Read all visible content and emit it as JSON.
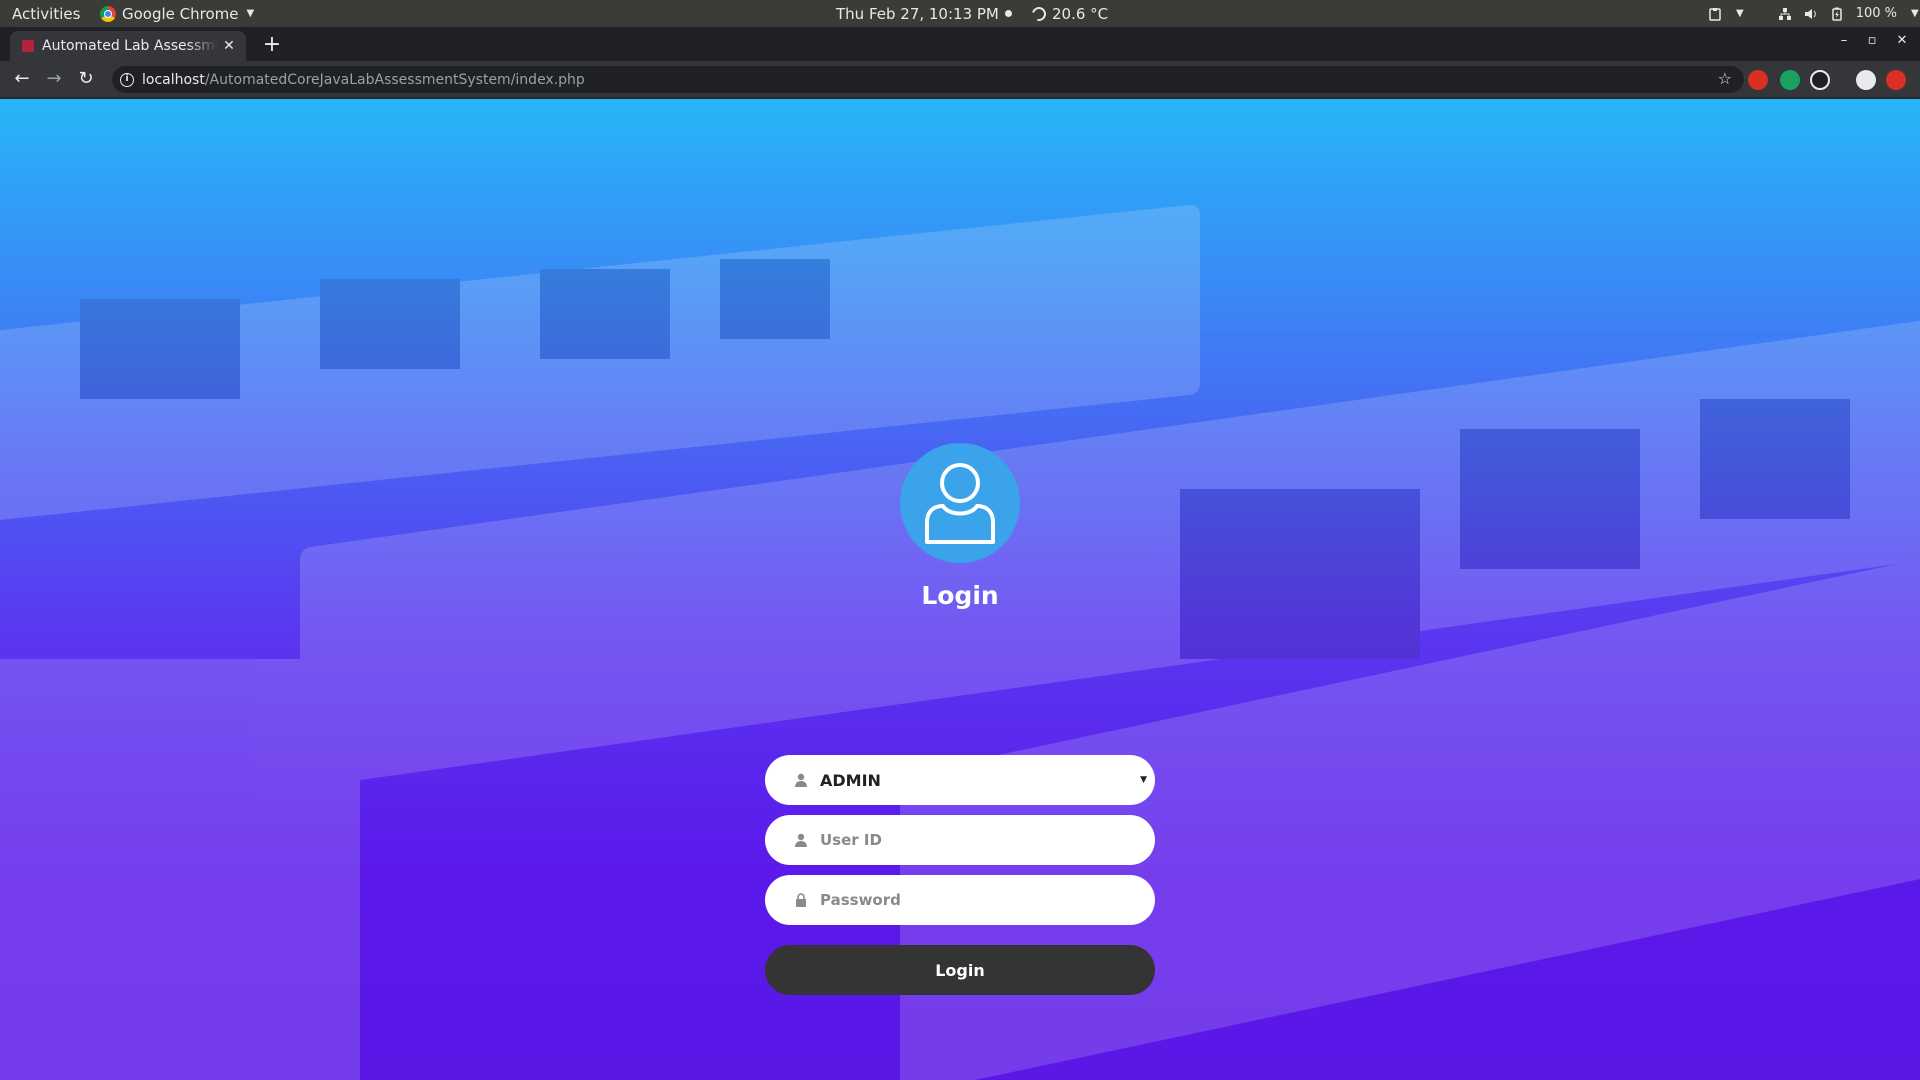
{
  "topbar": {
    "activities": "Activities",
    "app_name": "Google Chrome",
    "datetime": "Thu Feb 27, 10:13 PM",
    "weather": "20.6 °C",
    "battery": "100 %"
  },
  "browser": {
    "tab_title": "Automated Lab Assessment System",
    "url_host": "localhost",
    "url_path": "/AutomatedCoreJavaLabAssessmentSystem/index.php"
  },
  "login": {
    "title": "Login",
    "role_selected": "ADMIN",
    "user_id_placeholder": "User ID",
    "password_placeholder": "Password",
    "button_label": "Login"
  },
  "colors": {
    "gradient_top": "#27b6f8",
    "gradient_bottom": "#5a17e6",
    "avatar_bg": "#3aa3ea",
    "button_bg": "#343434"
  }
}
